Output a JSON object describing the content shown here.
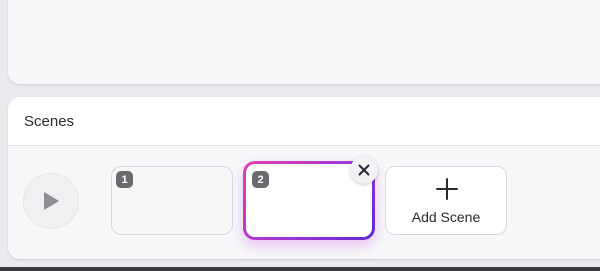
{
  "scenes_panel": {
    "title": "Scenes",
    "scenes": [
      {
        "number": "1",
        "selected": false
      },
      {
        "number": "2",
        "selected": true
      }
    ],
    "add_scene_label": "Add Scene"
  },
  "icons": {
    "play": "play-icon",
    "remove": "close-icon",
    "add": "plus-icon"
  },
  "colors": {
    "selection_gradient_start": "#e23fb6",
    "selection_gradient_end": "#5b2bd1"
  }
}
